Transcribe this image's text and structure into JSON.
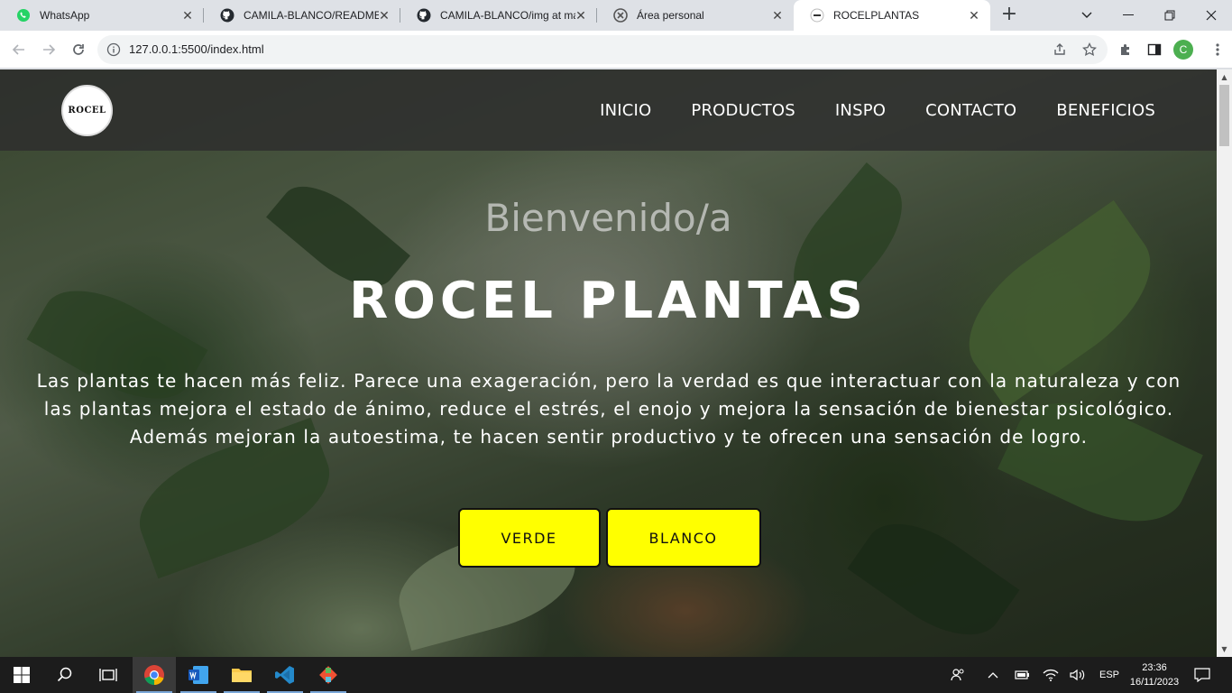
{
  "browser": {
    "tabs": [
      {
        "title": "WhatsApp",
        "icon": "whatsapp-icon"
      },
      {
        "title": "CAMILA-BLANCO/README.md",
        "icon": "github-icon"
      },
      {
        "title": "CAMILA-BLANCO/img at main",
        "icon": "github-icon"
      },
      {
        "title": "Área personal",
        "icon": "moodle-icon"
      },
      {
        "title": "ROCELPLANTAS",
        "icon": "rocel-favicon",
        "active": true
      }
    ],
    "url": "127.0.0.1:5500/index.html",
    "profile_initial": "C"
  },
  "page": {
    "logo_text": "ROCEL",
    "nav": [
      "INICIO",
      "PRODUCTOS",
      "INSPO",
      "CONTACTO",
      "BENEFICIOS"
    ],
    "welcome": "Bienvenido/a",
    "brand": "ROCEL PLANTAS",
    "description": "Las plantas te hacen más feliz. Parece una exageración, pero la verdad es que interactuar con la naturaleza y con las plantas mejora el estado de ánimo, reduce el estrés, el enojo y mejora la sensación de bienestar psicológico. Además mejoran la autoestima, te hacen sentir productivo y te ofrecen una sensación de logro.",
    "buttons": [
      "VERDE",
      "BLANCO"
    ],
    "button_color": "#ffff00"
  },
  "taskbar": {
    "language": "ESP",
    "time": "23:36",
    "date": "16/11/2023"
  }
}
